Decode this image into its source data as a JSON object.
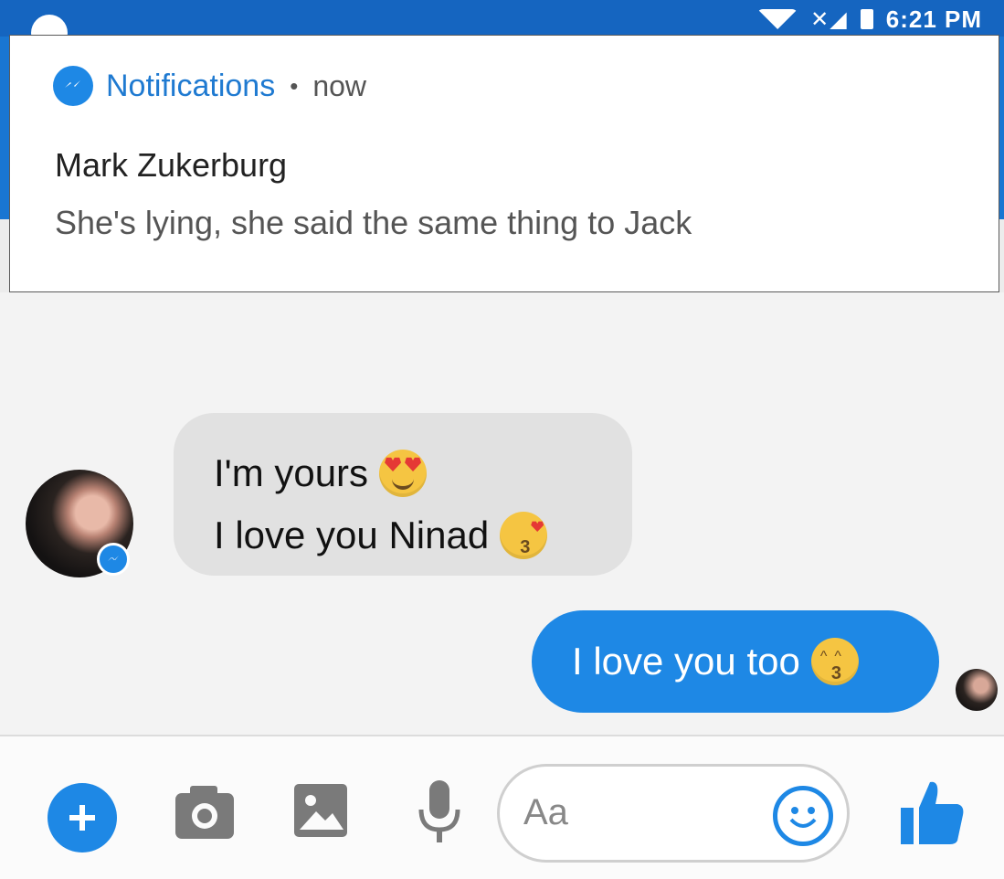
{
  "status_bar": {
    "time": "6:21 PM",
    "signal": "✕◢"
  },
  "notification": {
    "app": "Notifications",
    "separator": "•",
    "time": "now",
    "sender": "Mark Zukerburg",
    "message": "She's lying, she said the same thing to Jack"
  },
  "chat": {
    "incoming": {
      "lines": [
        "I'm yours",
        "I love you Ninad"
      ],
      "emojis": [
        "heart-eyes-emoji",
        "kissing-heart-emoji"
      ]
    },
    "outgoing": {
      "text": "I love you too",
      "emoji": "kissing-closed-eyes-emoji"
    }
  },
  "composer": {
    "placeholder": "Aa",
    "icons": [
      "plus-icon",
      "camera-icon",
      "gallery-icon",
      "microphone-icon",
      "emoji-icon",
      "thumbs-up-icon"
    ]
  },
  "colors": {
    "accent": "#1e88e5",
    "incoming_bubble": "#e1e1e1",
    "notification_app": "#1f7ad1"
  }
}
